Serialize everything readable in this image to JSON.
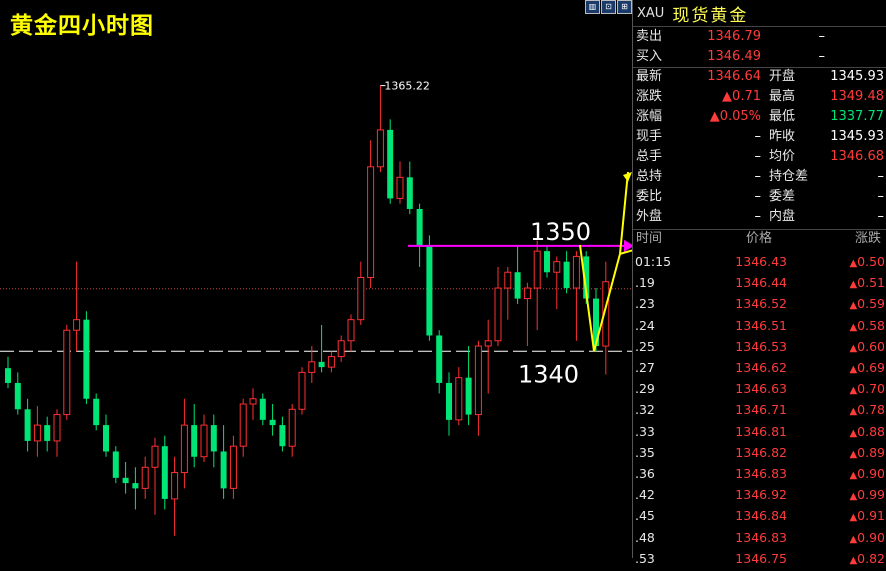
{
  "chart": {
    "title": "黄金四小时图",
    "high_label": "1365.22",
    "level_high_label": "1350",
    "level_low_label": "1340",
    "window_buttons": [
      "▥",
      "⊡",
      "⊞"
    ],
    "colors": {
      "up": "#ff3030",
      "down": "#00e676",
      "pink_line": "#ff00ff",
      "yellow": "#ffff00",
      "dash": "#ffffff"
    }
  },
  "panel": {
    "code": "XAU",
    "name": "现货黄金",
    "sell_label": "卖出",
    "sell_value": "1346.79",
    "sell_vol": "–",
    "buy_label": "买入",
    "buy_value": "1346.49",
    "buy_vol": "–",
    "rows": [
      {
        "l1": "最新",
        "v1": "1346.64",
        "c1": "red",
        "l2": "开盘",
        "v2": "1345.93",
        "c2": "white"
      },
      {
        "l1": "涨跌",
        "v1": "▲0.71",
        "c1": "red",
        "l2": "最高",
        "v2": "1349.48",
        "c2": "red"
      },
      {
        "l1": "涨幅",
        "v1": "▲0.05%",
        "c1": "red",
        "l2": "最低",
        "v2": "1337.77",
        "c2": "green"
      },
      {
        "l1": "现手",
        "v1": "–",
        "c1": "white",
        "l2": "昨收",
        "v2": "1345.93",
        "c2": "white"
      },
      {
        "l1": "总手",
        "v1": "–",
        "c1": "white",
        "l2": "均价",
        "v2": "1346.68",
        "c2": "red"
      },
      {
        "l1": "总持",
        "v1": "–",
        "c1": "white",
        "l2": "持仓差",
        "v2": "–",
        "c2": "white"
      },
      {
        "l1": "委比",
        "v1": "–",
        "c1": "white",
        "l2": "委差",
        "v2": "–",
        "c2": "white"
      },
      {
        "l1": "外盘",
        "v1": "–",
        "c1": "white",
        "l2": "内盘",
        "v2": "–",
        "c2": "white"
      }
    ],
    "tick_headers": {
      "time": "时间",
      "price": "价格",
      "change": "涨跌"
    },
    "ticks": [
      {
        "time": "01:15",
        "price": "1346.43",
        "chg": "0.50"
      },
      {
        "time": ".19",
        "price": "1346.44",
        "chg": "0.51"
      },
      {
        "time": ".23",
        "price": "1346.52",
        "chg": "0.59"
      },
      {
        "time": ".24",
        "price": "1346.51",
        "chg": "0.58"
      },
      {
        "time": ".25",
        "price": "1346.53",
        "chg": "0.60"
      },
      {
        "time": ".27",
        "price": "1346.62",
        "chg": "0.69"
      },
      {
        "time": ".29",
        "price": "1346.63",
        "chg": "0.70"
      },
      {
        "time": ".32",
        "price": "1346.71",
        "chg": "0.78"
      },
      {
        "time": ".33",
        "price": "1346.81",
        "chg": "0.88"
      },
      {
        "time": ".35",
        "price": "1346.82",
        "chg": "0.89"
      },
      {
        "time": ".36",
        "price": "1346.83",
        "chg": "0.90"
      },
      {
        "time": ".42",
        "price": "1346.92",
        "chg": "0.99"
      },
      {
        "time": ".45",
        "price": "1346.84",
        "chg": "0.91"
      },
      {
        "time": ".48",
        "price": "1346.83",
        "chg": "0.90"
      },
      {
        "time": ".53",
        "price": "1346.75",
        "chg": "0.82"
      }
    ]
  },
  "chart_data": {
    "type": "candlestick",
    "title": "黄金四小时图",
    "ylim": [
      1324,
      1370
    ],
    "reference_lines": [
      1350,
      1340,
      1345.93
    ],
    "annotated_high": 1365.22,
    "candles": [
      [
        1338.4,
        1339.5,
        1336.5,
        1337.0
      ],
      [
        1337.0,
        1338.0,
        1334.0,
        1334.5
      ],
      [
        1334.5,
        1335.5,
        1330.5,
        1331.5
      ],
      [
        1331.5,
        1334.8,
        1330.0,
        1333.0
      ],
      [
        1333.0,
        1333.8,
        1330.5,
        1331.5
      ],
      [
        1331.5,
        1334.5,
        1330.0,
        1334.0
      ],
      [
        1334.0,
        1342.5,
        1333.5,
        1342.0
      ],
      [
        1342.0,
        1348.5,
        1340.0,
        1343.0
      ],
      [
        1343.0,
        1343.8,
        1335.0,
        1335.5
      ],
      [
        1335.5,
        1336.0,
        1332.5,
        1333.0
      ],
      [
        1333.0,
        1334.0,
        1330.0,
        1330.5
      ],
      [
        1330.5,
        1331.0,
        1327.5,
        1328.0
      ],
      [
        1328.0,
        1329.5,
        1326.5,
        1327.5
      ],
      [
        1327.5,
        1329.0,
        1325.0,
        1327.0
      ],
      [
        1327.0,
        1330.0,
        1326.0,
        1329.0
      ],
      [
        1329.0,
        1331.8,
        1324.5,
        1331.0
      ],
      [
        1331.0,
        1332.0,
        1325.0,
        1326.0
      ],
      [
        1326.0,
        1330.0,
        1322.5,
        1328.5
      ],
      [
        1328.5,
        1335.5,
        1327.0,
        1333.0
      ],
      [
        1333.0,
        1335.0,
        1329.0,
        1330.0
      ],
      [
        1330.0,
        1334.0,
        1329.5,
        1333.0
      ],
      [
        1333.0,
        1334.0,
        1329.0,
        1330.5
      ],
      [
        1330.5,
        1333.0,
        1326.0,
        1327.0
      ],
      [
        1327.0,
        1332.0,
        1326.0,
        1331.0
      ],
      [
        1331.0,
        1335.5,
        1330.0,
        1335.0
      ],
      [
        1335.0,
        1336.5,
        1333.5,
        1335.5
      ],
      [
        1335.5,
        1336.0,
        1333.0,
        1333.5
      ],
      [
        1333.5,
        1335.0,
        1332.0,
        1333.0
      ],
      [
        1333.0,
        1333.8,
        1330.5,
        1331.0
      ],
      [
        1331.0,
        1335.0,
        1330.0,
        1334.5
      ],
      [
        1334.5,
        1338.5,
        1334.0,
        1338.0
      ],
      [
        1338.0,
        1340.5,
        1337.0,
        1339.0
      ],
      [
        1339.0,
        1342.5,
        1338.0,
        1338.5
      ],
      [
        1338.5,
        1340.0,
        1338.0,
        1339.5
      ],
      [
        1339.5,
        1341.5,
        1339.0,
        1341.0
      ],
      [
        1341.0,
        1343.5,
        1340.0,
        1343.0
      ],
      [
        1343.0,
        1348.5,
        1342.5,
        1347.0
      ],
      [
        1347.0,
        1360.0,
        1346.0,
        1357.5
      ],
      [
        1357.5,
        1365.2,
        1357.0,
        1361.0
      ],
      [
        1361.0,
        1362.0,
        1354.0,
        1354.5
      ],
      [
        1354.5,
        1358.0,
        1354.0,
        1356.5
      ],
      [
        1356.5,
        1358.0,
        1353.0,
        1353.5
      ],
      [
        1353.5,
        1354.0,
        1348.0,
        1350.0
      ],
      [
        1350.0,
        1351.0,
        1341.0,
        1341.5
      ],
      [
        1341.5,
        1342.0,
        1336.0,
        1337.0
      ],
      [
        1337.0,
        1338.0,
        1332.0,
        1333.5
      ],
      [
        1333.5,
        1338.5,
        1333.0,
        1337.5
      ],
      [
        1337.5,
        1340.5,
        1333.0,
        1334.0
      ],
      [
        1334.0,
        1341.0,
        1332.0,
        1340.5
      ],
      [
        1340.5,
        1343.0,
        1336.0,
        1341.0
      ],
      [
        1341.0,
        1348.0,
        1340.5,
        1346.0
      ],
      [
        1346.0,
        1348.0,
        1343.0,
        1347.5
      ],
      [
        1347.5,
        1350.0,
        1344.5,
        1345.0
      ],
      [
        1345.0,
        1346.5,
        1340.5,
        1346.0
      ],
      [
        1346.0,
        1350.5,
        1342.0,
        1349.5
      ],
      [
        1349.5,
        1350.0,
        1347.0,
        1347.5
      ],
      [
        1347.5,
        1349.0,
        1344.0,
        1348.5
      ],
      [
        1348.5,
        1349.5,
        1345.5,
        1346.0
      ],
      [
        1346.0,
        1349.5,
        1341.0,
        1349.0
      ],
      [
        1349.0,
        1349.5,
        1344.5,
        1345.0
      ],
      [
        1345.0,
        1346.0,
        1340.0,
        1340.5
      ],
      [
        1340.5,
        1348.5,
        1337.8,
        1346.6
      ]
    ]
  }
}
